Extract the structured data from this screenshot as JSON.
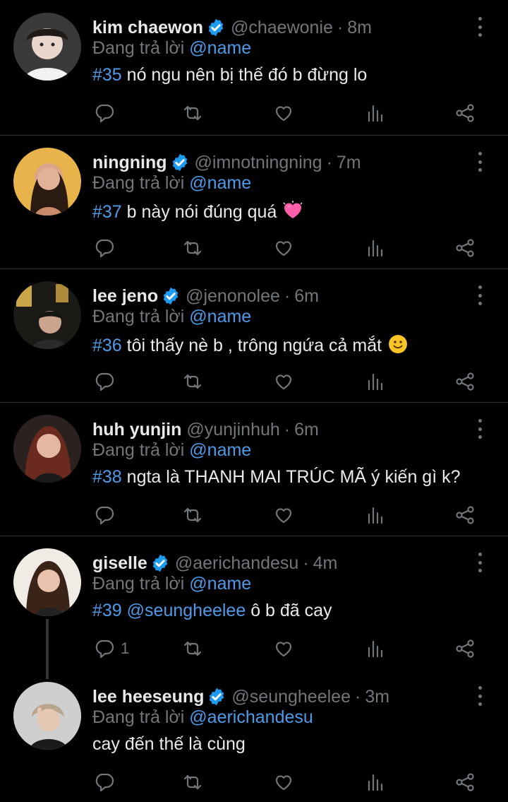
{
  "colors": {
    "background": "#000000",
    "text": "#e7e9ea",
    "secondary": "#71767b",
    "link": "#4f9ae8",
    "verified": "#1d9bf0",
    "divider": "#2f3336"
  },
  "tweets": [
    {
      "name": "kim chaewon",
      "verified": true,
      "handle": "@chaewonie",
      "time": "8m",
      "reply_prefix": "Đang trả lời",
      "reply_to": "@name",
      "tag": "#35",
      "text": " nó ngu nên bị thế đó b đừng lo",
      "emoji": "",
      "reply_count": ""
    },
    {
      "name": "ningning",
      "verified": true,
      "handle": "@imnotningning",
      "time": "7m",
      "reply_prefix": "Đang trả lời",
      "reply_to": "@name",
      "tag": "#37",
      "text": " b này nói đúng quá",
      "emoji": "heart-emoji",
      "reply_count": ""
    },
    {
      "name": "lee jeno",
      "verified": true,
      "handle": "@jenonolee",
      "time": "6m",
      "reply_prefix": "Đang trả lời",
      "reply_to": "@name",
      "tag": "#36",
      "text": " tôi thấy nè b , trông ngứa cả mắt",
      "emoji": "smile-emoji",
      "reply_count": ""
    },
    {
      "name": "huh yunjin",
      "verified": false,
      "handle": "@yunjinhuh",
      "time": "6m",
      "reply_prefix": "Đang trả lời",
      "reply_to": "@name",
      "tag": "#38",
      "text": " ngta là THANH MAI TRÚC MÃ ý kiến gì k?",
      "emoji": "",
      "reply_count": ""
    },
    {
      "name": "giselle",
      "verified": true,
      "handle": "@aerichandesu",
      "time": "4m",
      "reply_prefix": "Đang trả lời",
      "reply_to": "@name",
      "tag": "#39",
      "mention_in_text": "@seungheelee",
      "text": " ô b đã cay",
      "emoji": "",
      "reply_count": "1"
    },
    {
      "name": "lee heeseung",
      "verified": true,
      "handle": "@seungheelee",
      "time": "3m",
      "reply_prefix": "Đang trả lời",
      "reply_to": "@aerichandesu",
      "tag": "",
      "text": "cay đến thế là cùng",
      "emoji": "",
      "reply_count": ""
    }
  ],
  "separator": "·",
  "icons": [
    "reply-icon",
    "retweet-icon",
    "like-icon",
    "views-icon",
    "share-icon",
    "more-icon",
    "verified-badge-icon"
  ]
}
